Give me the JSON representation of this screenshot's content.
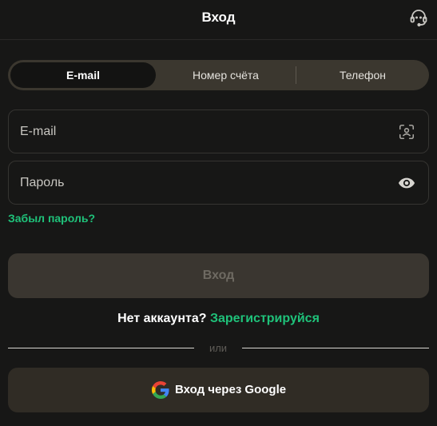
{
  "header": {
    "title": "Вход",
    "support_icon": "headset-icon"
  },
  "tabs": [
    {
      "label": "E-mail",
      "active": true
    },
    {
      "label": "Номер счёта",
      "active": false
    },
    {
      "label": "Телефон",
      "active": false
    }
  ],
  "email_field": {
    "placeholder": "E-mail",
    "value": "",
    "icon": "face-scan-icon"
  },
  "password_field": {
    "placeholder": "Пароль",
    "value": "",
    "icon": "eye-icon"
  },
  "forgot_password": "Забыл пароль?",
  "submit_label": "Вход",
  "register": {
    "question": "Нет аккаунта?",
    "link": "Зарегистрируйся"
  },
  "divider_text": "или",
  "google_button": {
    "label": "Вход через Google",
    "icon": "google-icon"
  },
  "colors": {
    "accent": "#1fc27a",
    "background": "#171716",
    "button": "#3a3630",
    "tabs_bg": "#3b372f"
  }
}
